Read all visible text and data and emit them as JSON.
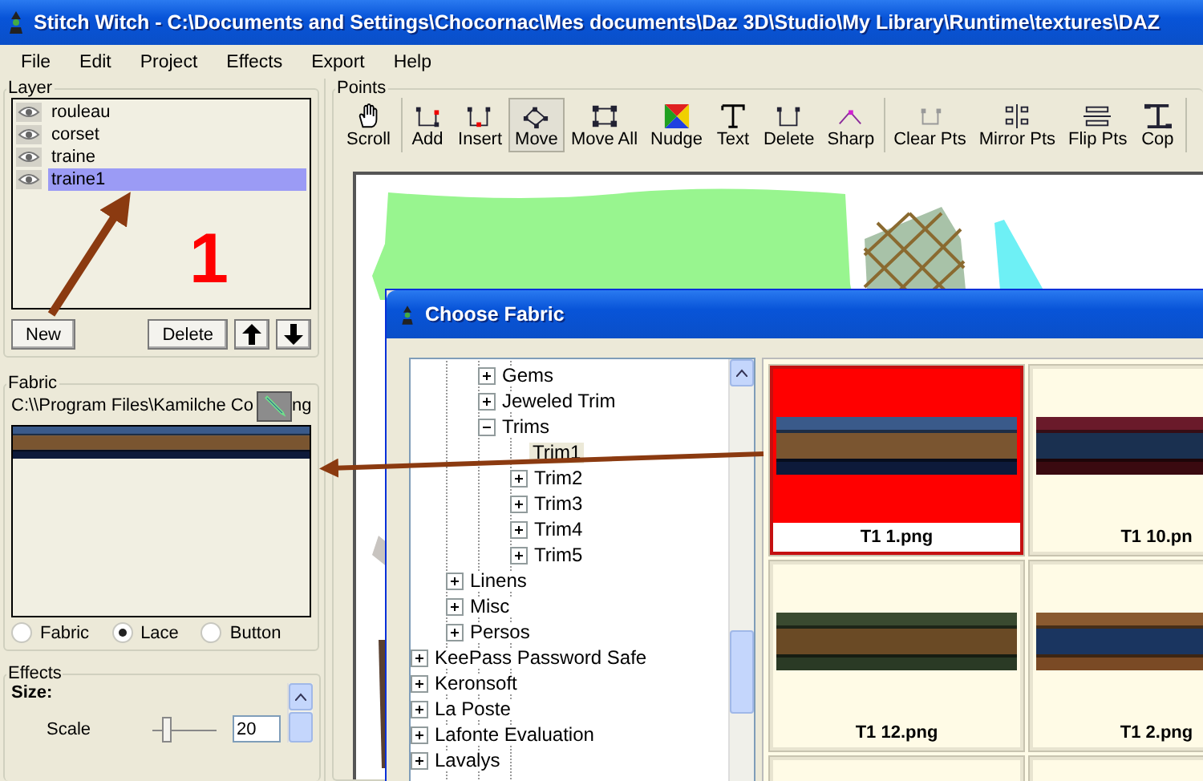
{
  "window": {
    "title": "Stitch Witch - C:\\Documents and Settings\\Chocornac\\Mes documents\\Daz 3D\\Studio\\My Library\\Runtime\\textures\\DAZ"
  },
  "menu": [
    "File",
    "Edit",
    "Project",
    "Effects",
    "Export",
    "Help"
  ],
  "layer_panel": {
    "title": "Layer",
    "layers": [
      {
        "name": "rouleau",
        "selected": false
      },
      {
        "name": "corset",
        "selected": false
      },
      {
        "name": "traine",
        "selected": false
      },
      {
        "name": "traine1",
        "selected": true
      }
    ],
    "buttons": [
      "New",
      "Delete"
    ]
  },
  "annotation_number": "1",
  "fabric_panel": {
    "title": "Fabric",
    "path": "C:\\\\Program Files\\Kamilche Co",
    "path_end": "ng",
    "options": [
      {
        "label": "Fabric",
        "selected": false
      },
      {
        "label": "Lace",
        "selected": true
      },
      {
        "label": "Button",
        "selected": false
      }
    ]
  },
  "effects_panel": {
    "title": "Effects",
    "section": "Size:",
    "scale_label": "Scale",
    "scale_value": "20",
    "scale_slider": {
      "level": 0.15
    }
  },
  "points_panel": {
    "title": "Points",
    "tool_groups": [
      [
        {
          "label": "Scroll",
          "kind": "hand",
          "selected": false
        }
      ],
      [
        {
          "label": "Add",
          "kind": "add",
          "selected": false
        },
        {
          "label": "Insert",
          "kind": "insert",
          "selected": false
        },
        {
          "label": "Move",
          "kind": "move",
          "selected": true
        },
        {
          "label": "Move All",
          "kind": "moveall",
          "selected": false
        },
        {
          "label": "Nudge",
          "kind": "nudge",
          "selected": false
        },
        {
          "label": "Text",
          "kind": "text",
          "selected": false
        },
        {
          "label": "Delete",
          "kind": "delete",
          "selected": false
        },
        {
          "label": "Sharp",
          "kind": "sharp",
          "selected": false
        }
      ],
      [
        {
          "label": "Clear Pts",
          "kind": "clear",
          "selected": false
        },
        {
          "label": "Mirror Pts",
          "kind": "mirror",
          "selected": false
        },
        {
          "label": "Flip Pts",
          "kind": "flip",
          "selected": false
        },
        {
          "label": "Cop",
          "kind": "copy",
          "selected": false
        }
      ]
    ]
  },
  "dialog": {
    "title": "Choose Fabric",
    "tree": [
      {
        "children": [
          {
            "children": [
              {
                "children": [
                  {
                    "children": [
                      {
                        "label": "Gems",
                        "expanded": false
                      },
                      {
                        "label": "Jeweled Trim",
                        "expanded": false
                      },
                      {
                        "label": "Trims",
                        "expanded": true,
                        "children": [
                          {
                            "label": "Trim1",
                            "selected": true
                          },
                          {
                            "label": "Trim2",
                            "expanded": false
                          },
                          {
                            "label": "Trim3",
                            "expanded": false
                          },
                          {
                            "label": "Trim4",
                            "expanded": false
                          },
                          {
                            "label": "Trim5",
                            "expanded": false
                          }
                        ]
                      }
                    ]
                  },
                  {
                    "label": "Linens",
                    "expanded": false
                  },
                  {
                    "label": "Misc",
                    "expanded": false
                  },
                  {
                    "label": "Persos",
                    "expanded": false
                  }
                ]
              }
            ]
          }
        ]
      },
      {
        "label": "KeePass Password Safe",
        "expanded": false
      },
      {
        "label": "Keronsoft",
        "expanded": false
      },
      {
        "label": "La Poste",
        "expanded": false
      },
      {
        "label": "Lafonte Evaluation",
        "expanded": false
      },
      {
        "label": "Lavalys",
        "expanded": false
      }
    ],
    "thumbnails": [
      {
        "name": "T1 1.png",
        "selected": true
      },
      {
        "name": "T1 10.pn",
        "selected": false
      },
      {
        "name": "T1 12.png",
        "selected": false
      },
      {
        "name": "T1 2.png",
        "selected": false
      }
    ]
  }
}
